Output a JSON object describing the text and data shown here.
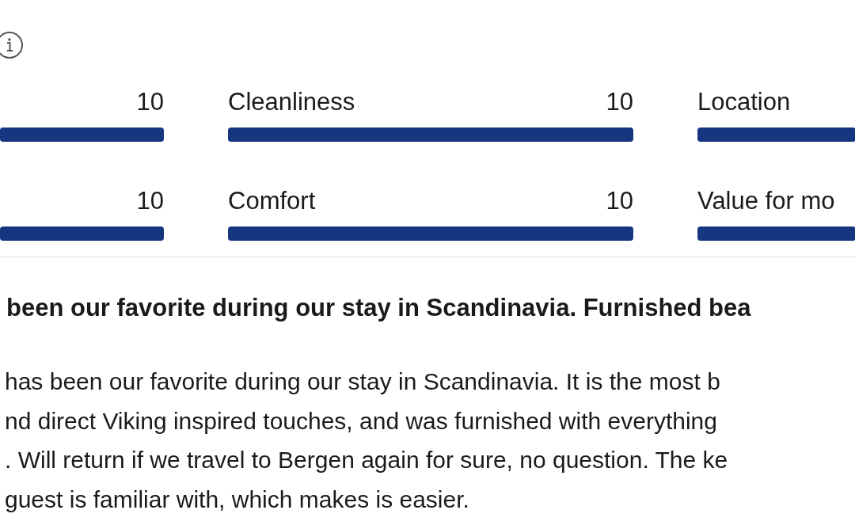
{
  "ratings": [
    {
      "score": "10",
      "level": 1
    },
    {
      "label": "Cleanliness",
      "score": "10",
      "level": 1
    },
    {
      "label": "Location",
      "level": 1
    },
    {
      "score": "10",
      "level": 1
    },
    {
      "label": "Comfort",
      "score": "10",
      "level": 1
    },
    {
      "label": "Value for mo",
      "level": 1
    }
  ],
  "review": {
    "title": "been our favorite during our stay in Scandinavia. Furnished bea",
    "body_lines": [
      "has been our favorite during our stay in Scandinavia. It is the most b",
      "nd direct Viking inspired touches, and was furnished with everything",
      ". Will return if we travel to Bergen again for sure, no question. The ke",
      "guest is familiar with, which makes is easier."
    ]
  }
}
